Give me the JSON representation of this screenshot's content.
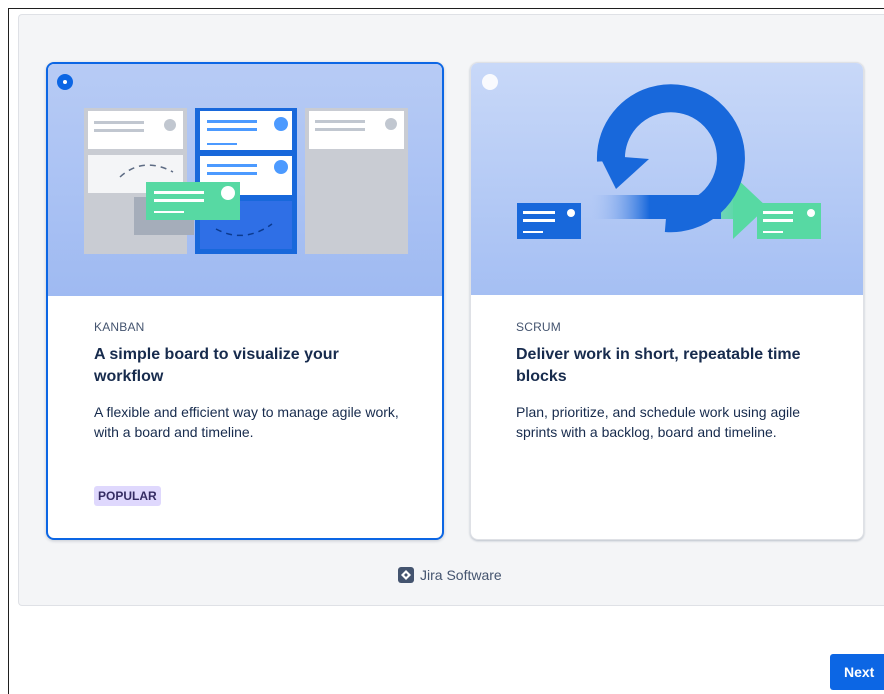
{
  "cards": [
    {
      "eyebrow": "KANBAN",
      "title": "A simple board to visualize your workflow",
      "description": "A flexible and efficient way to manage agile work, with a board and timeline.",
      "badge": "POPULAR",
      "selected": true
    },
    {
      "eyebrow": "SCRUM",
      "title": "Deliver work in short, repeatable time blocks",
      "description": "Plan, prioritize, and schedule work using agile sprints with a backlog, board and timeline.",
      "selected": false
    }
  ],
  "footer": {
    "brand": "Jira Software"
  },
  "actions": {
    "next_label": "Next"
  },
  "icons": {
    "selected_radio": "radio-selected-icon",
    "unselected_radio": "radio-unselected-icon",
    "brand": "jira-logo-icon"
  },
  "colors": {
    "accent": "#0c66e4",
    "badge_bg": "#dfd8fd",
    "badge_text": "#352c63",
    "panel_bg": "#f4f5f7",
    "green_card": "#57d9a3"
  }
}
